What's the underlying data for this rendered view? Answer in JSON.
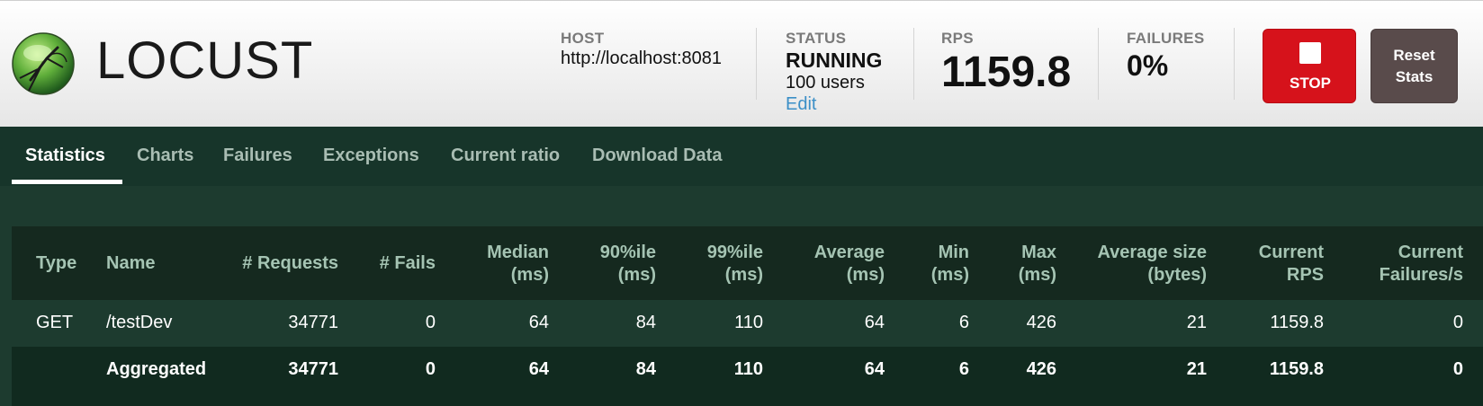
{
  "brand": {
    "logo_text": "LOCUST",
    "logo_icon": "locust-globe-icon"
  },
  "header": {
    "host_label": "HOST",
    "host_value": "http://localhost:8081",
    "status_label": "STATUS",
    "status_value": "RUNNING",
    "users_value": "100 users",
    "edit_label": "Edit",
    "rps_label": "RPS",
    "rps_value": "1159.8",
    "failures_label": "FAILURES",
    "failures_value": "0%",
    "stop_label": "STOP",
    "reset_label_line1": "Reset",
    "reset_label_line2": "Stats"
  },
  "tabs": [
    {
      "label": "Statistics",
      "active": true
    },
    {
      "label": "Charts"
    },
    {
      "label": "Failures"
    },
    {
      "label": "Exceptions"
    },
    {
      "label": "Current ratio"
    },
    {
      "label": "Download Data"
    }
  ],
  "table": {
    "headers": {
      "type": "Type",
      "name": "Name",
      "requests": "# Requests",
      "fails": "# Fails",
      "median_1": "Median",
      "median_2": "(ms)",
      "p90_1": "90%ile",
      "p90_2": "(ms)",
      "p99_1": "99%ile",
      "p99_2": "(ms)",
      "avg_1": "Average",
      "avg_2": "(ms)",
      "min_1": "Min",
      "min_2": "(ms)",
      "max_1": "Max",
      "max_2": "(ms)",
      "size_1": "Average size",
      "size_2": "(bytes)",
      "rps_1": "Current",
      "rps_2": "RPS",
      "cfail_1": "Current",
      "cfail_2": "Failures/s"
    },
    "rows": [
      {
        "type": "GET",
        "name": "/testDev",
        "requests": "34771",
        "fails": "0",
        "median": "64",
        "p90": "84",
        "p99": "110",
        "avg": "64",
        "min": "6",
        "max": "426",
        "size": "21",
        "rps": "1159.8",
        "cfail": "0"
      },
      {
        "type": "",
        "name": "Aggregated",
        "requests": "34771",
        "fails": "0",
        "median": "64",
        "p90": "84",
        "p99": "110",
        "avg": "64",
        "min": "6",
        "max": "426",
        "size": "21",
        "rps": "1159.8",
        "cfail": "0"
      }
    ]
  },
  "colors": {
    "stop_red": "#d6121b",
    "reset_brown": "#594b4b",
    "nav_bg": "#17352a",
    "table_header_text": "#a5c4b3",
    "edit_link": "#3b8fc7"
  }
}
